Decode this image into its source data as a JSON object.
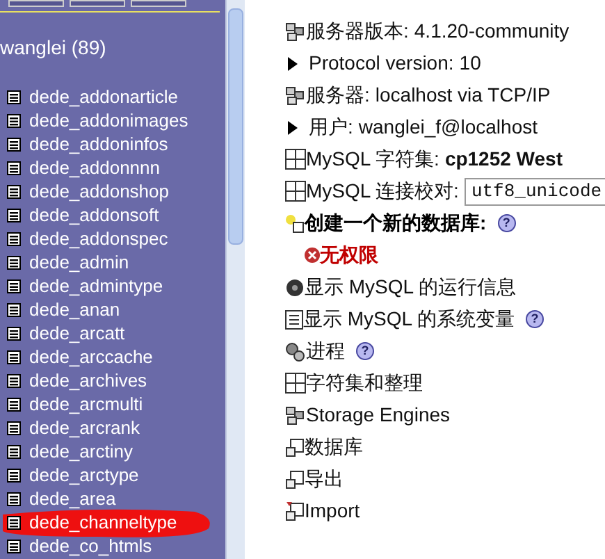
{
  "sidebar": {
    "database": "wanglei (89)",
    "tables": [
      {
        "name": "dede_addonarticle",
        "highlighted": false
      },
      {
        "name": "dede_addonimages",
        "highlighted": false
      },
      {
        "name": "dede_addoninfos",
        "highlighted": false
      },
      {
        "name": "dede_addonnnn",
        "highlighted": false
      },
      {
        "name": "dede_addonshop",
        "highlighted": false
      },
      {
        "name": "dede_addonsoft",
        "highlighted": false
      },
      {
        "name": "dede_addonspec",
        "highlighted": false
      },
      {
        "name": "dede_admin",
        "highlighted": false
      },
      {
        "name": "dede_admintype",
        "highlighted": false
      },
      {
        "name": "dede_anan",
        "highlighted": false
      },
      {
        "name": "dede_arcatt",
        "highlighted": false
      },
      {
        "name": "dede_arccache",
        "highlighted": false
      },
      {
        "name": "dede_archives",
        "highlighted": false
      },
      {
        "name": "dede_arcmulti",
        "highlighted": false
      },
      {
        "name": "dede_arcrank",
        "highlighted": false
      },
      {
        "name": "dede_arctiny",
        "highlighted": false
      },
      {
        "name": "dede_arctype",
        "highlighted": false
      },
      {
        "name": "dede_area",
        "highlighted": false
      },
      {
        "name": "dede_channeltype",
        "highlighted": true
      },
      {
        "name": "dede_co_htmls",
        "highlighted": false
      }
    ]
  },
  "help_glyph": "?",
  "main": [
    {
      "kind": "server",
      "label": "服务器版本:",
      "value": "4.1.20-community"
    },
    {
      "kind": "bullet",
      "label": "Protocol version:",
      "value": "10"
    },
    {
      "kind": "server",
      "label": "服务器:",
      "value": "localhost via TCP/IP"
    },
    {
      "kind": "bullet",
      "label": "用户:",
      "value": "wanglei_f@localhost"
    },
    {
      "kind": "charset",
      "label": "MySQL 字符集:",
      "value": "cp1252 West"
    },
    {
      "kind": "collation",
      "label": "MySQL 连接校对:",
      "value": "utf8_unicode"
    },
    {
      "kind": "create",
      "label": "创建一个新的数据库:",
      "help": true
    },
    {
      "kind": "error",
      "label": "无权限"
    },
    {
      "kind": "status",
      "label": "显示 MySQL 的运行信息",
      "help": false
    },
    {
      "kind": "variables",
      "label": "显示 MySQL 的系统变量",
      "help": true
    },
    {
      "kind": "process",
      "label": "进程",
      "help": true
    },
    {
      "kind": "charset",
      "label": "字符集和整理"
    },
    {
      "kind": "engines",
      "label": "Storage Engines"
    },
    {
      "kind": "database",
      "label": "数据库"
    },
    {
      "kind": "export",
      "label": "导出"
    },
    {
      "kind": "import",
      "label": "Import"
    }
  ]
}
